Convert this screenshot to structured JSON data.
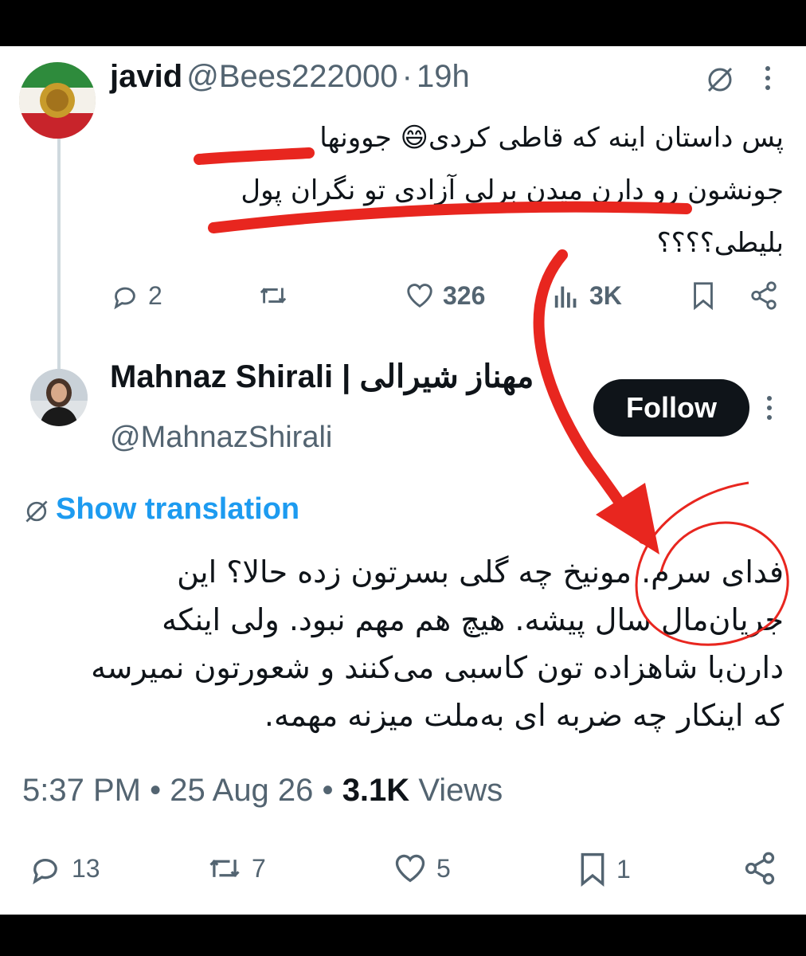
{
  "tweet1": {
    "name": "javid",
    "handle": "@Bees222000",
    "separator": "·",
    "time": "19h",
    "text_line1": "پس داستان اینه که قاطی کردی😄 جوونها",
    "text_line2": "جونشون رو دارن میدن برلی آزادی تو نگران پول",
    "text_line3": "بلیطی؟؟؟؟",
    "stats": {
      "replies": "2",
      "likes": "326",
      "views": "3K"
    }
  },
  "tweet2": {
    "name": "Mahnaz Shirali | مهناز شیرالی",
    "handle": "@MahnazShirali",
    "follow_label": "Follow",
    "show_translation": "Show translation",
    "text_line1": "فدای سرم. مونیخ چه گلی بسرتون زده حالا؟ این",
    "text_line2": "جریان‌مال سال پیشه. هیچ هم مهم نبود. ولی اینکه",
    "text_line3": "دارن‌با شاهزاده تون کاسبی می‌کنند و شعورتون نمیرسه",
    "text_line4": "که اینکار چه ضربه ای به‌ملت میزنه مهمه.",
    "time": "5:37 PM",
    "date": "25 Aug 26",
    "views_count": "3.1K",
    "views_label": "Views",
    "dot": "•",
    "stats": {
      "replies": "13",
      "reposts": "7",
      "likes": "5",
      "bookmarks": "1"
    }
  },
  "colors": {
    "accent": "#1d9bf0",
    "annotation_red": "#e8261f",
    "muted": "#536471"
  },
  "icons": [
    "grok-icon",
    "more-icon",
    "reply-icon",
    "repost-icon",
    "like-icon",
    "views-icon",
    "bookmark-icon",
    "share-icon",
    "translate-icon"
  ]
}
